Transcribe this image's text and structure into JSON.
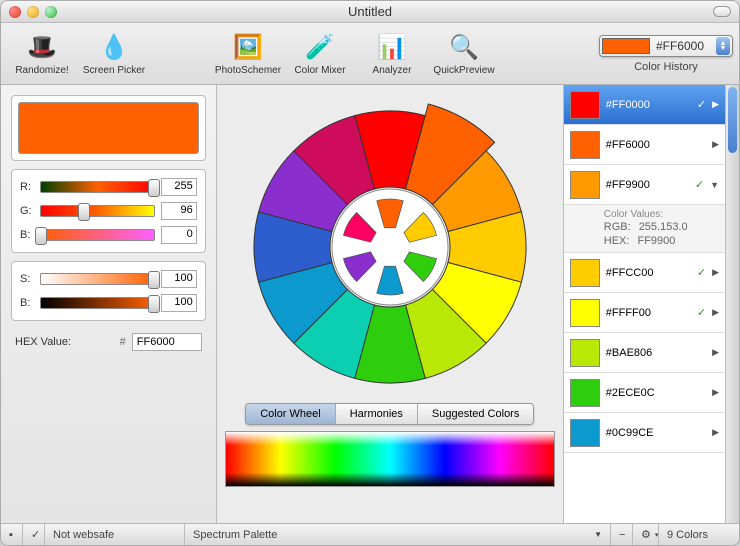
{
  "window": {
    "title": "Untitled"
  },
  "toolbar": {
    "randomize": "Randomize!",
    "screenpicker": "Screen Picker",
    "photoschemer": "PhotoSchemer",
    "colormixer": "Color Mixer",
    "analyzer": "Analyzer",
    "quickpreview": "QuickPreview"
  },
  "hexdrop": {
    "swatch": "#FF6000",
    "hex": "#FF6000"
  },
  "history_label": "Color History",
  "left": {
    "current_swatch": "#FF6000",
    "rgb": {
      "r_label": "R:",
      "r_value": "255",
      "r_pct": 100,
      "g_label": "G:",
      "g_value": "96",
      "g_pct": 38,
      "b_label": "B:",
      "b_value": "0",
      "b_pct": 0
    },
    "sb": {
      "s_label": "S:",
      "s_value": "100",
      "s_pct": 100,
      "b_label": "B:",
      "b_value": "100",
      "b_pct": 100
    },
    "hex_label": "HEX Value:",
    "hex_hash": "#",
    "hex_value": "FF6000"
  },
  "center": {
    "tabs": {
      "wheel": "Color Wheel",
      "harmonies": "Harmonies",
      "suggested": "Suggested Colors"
    },
    "active_tab": "wheel"
  },
  "history": {
    "items": [
      {
        "color": "#FF0000",
        "hex": "#FF0000",
        "check": true,
        "selected": true
      },
      {
        "color": "#FF6000",
        "hex": "#FF6000"
      },
      {
        "color": "#FF9900",
        "hex": "#FF9900",
        "check": true,
        "expanded": true
      },
      {
        "color": "#FFCC00",
        "hex": "#FFCC00",
        "check": true
      },
      {
        "color": "#FFFF00",
        "hex": "#FFFF00",
        "check": true
      },
      {
        "color": "#BAE806",
        "hex": "#BAE806"
      },
      {
        "color": "#2ECE0C",
        "hex": "#2ECE0C"
      },
      {
        "color": "#0C99CE",
        "hex": "#0C99CE"
      }
    ],
    "details": {
      "title": "Color Values:",
      "rgb_label": "RGB:",
      "rgb_value": "255.153.0",
      "hex_label": "HEX:",
      "hex_value": "FF9900"
    }
  },
  "status": {
    "websafe": "Not websafe",
    "spectrum": "Spectrum Palette",
    "count": "9 Colors"
  }
}
